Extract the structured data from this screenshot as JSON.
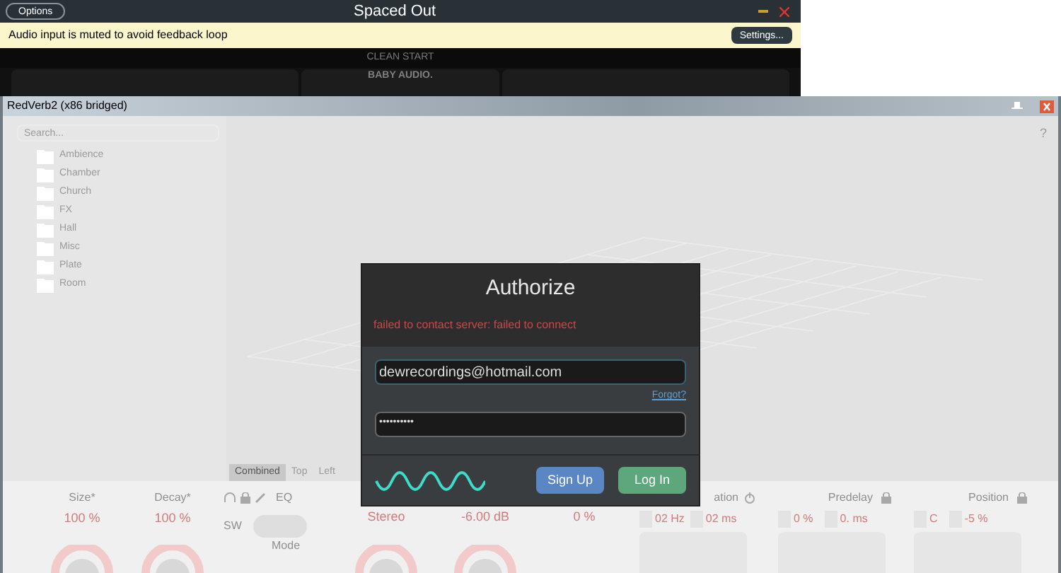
{
  "spaced_out": {
    "title": "Spaced Out",
    "options_button": "Options",
    "notice": "Audio input is muted to avoid feedback loop",
    "settings_button": "Settings...",
    "preset": "CLEAN START",
    "brand": "BABY AUDIO."
  },
  "redverb": {
    "title": "RedVerb2 (x86 bridged)",
    "help": "?",
    "search": {
      "placeholder": "Search..."
    },
    "folders": [
      "Ambience",
      "Chamber",
      "Church",
      "FX",
      "Hall",
      "Misc",
      "Plate",
      "Room"
    ],
    "view_tabs": [
      {
        "label": "Combined",
        "selected": true
      },
      {
        "label": "Top",
        "selected": false
      },
      {
        "label": "Left",
        "selected": false
      }
    ],
    "knob_params": [
      {
        "label": "Size*",
        "value": "100 %"
      },
      {
        "label": "Decay*",
        "value": "100 %"
      }
    ],
    "eq_label": "EQ",
    "switch_label": "SW",
    "mode_label": "Mode",
    "mode_on": false,
    "output_values": [
      "Stereo",
      "-6.00 dB",
      "0 %"
    ],
    "modulation_label": "ation",
    "modulation_values": [
      "02 Hz",
      "02 ms"
    ],
    "predelay": {
      "label": "Predelay",
      "values": [
        "0 %",
        "0. ms"
      ]
    },
    "position": {
      "label": "Position",
      "values": [
        "C",
        "-5 %"
      ]
    }
  },
  "dialog": {
    "title": "Authorize",
    "error": "failed to contact server: failed to connect",
    "email": "dewrecordings@hotmail.com",
    "forgot": "Forgot?",
    "password": "••••••••••",
    "sign_up": "Sign Up",
    "log_in": "Log In"
  }
}
